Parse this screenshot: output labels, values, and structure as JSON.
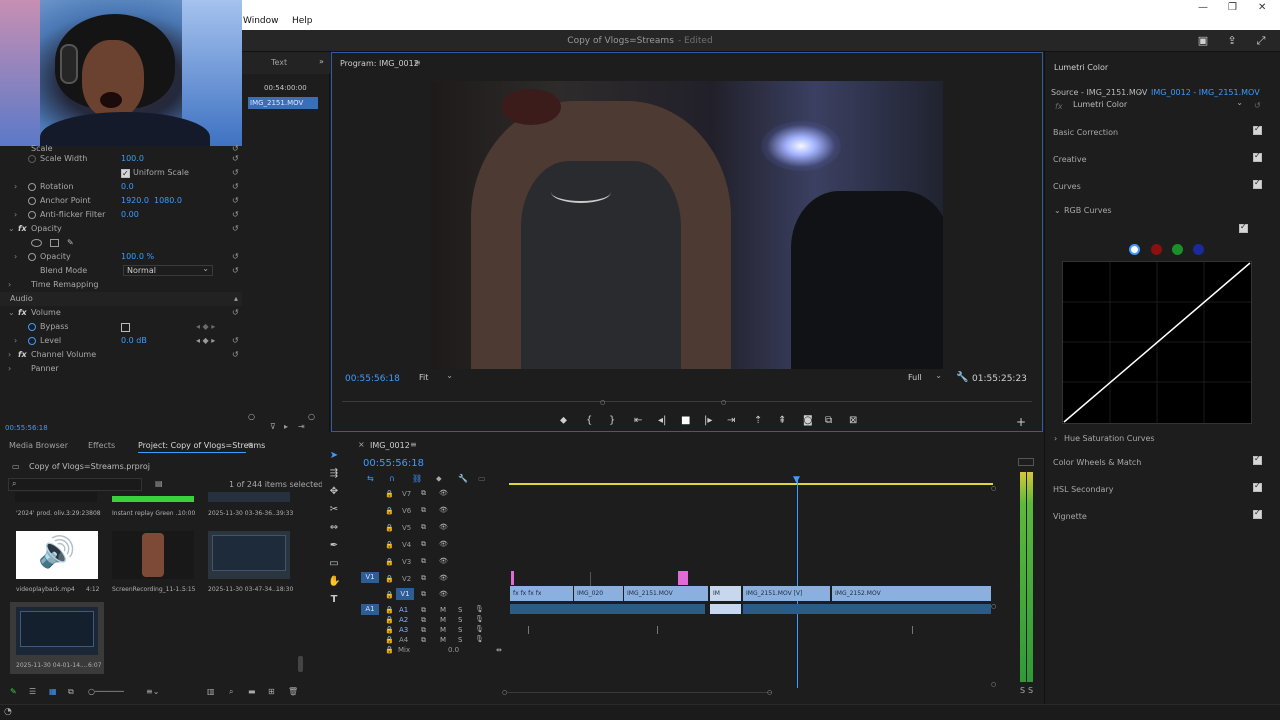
{
  "menu": {
    "items": [
      "Window",
      "Help"
    ]
  },
  "titlebar": {
    "document": "Copy of Vlogs=Streams",
    "status": "- Edited"
  },
  "source": {
    "tab": "Text",
    "timecode": "00:54:00:00",
    "clip": "IMG_2151.MOV"
  },
  "effect_controls": {
    "scale_label": "Scale",
    "scale_width_label": "Scale Width",
    "scale_width_value": "100.0",
    "uniform_scale": "Uniform Scale",
    "rotation_label": "Rotation",
    "rotation_value": "0.0",
    "anchor_label": "Anchor Point",
    "anchor_x": "1920.0",
    "anchor_y": "1080.0",
    "antiflicker_label": "Anti-flicker Filter",
    "antiflicker_value": "0.00",
    "opacity_section": "Opacity",
    "opacity_label": "Opacity",
    "opacity_value": "100.0 %",
    "blend_label": "Blend Mode",
    "blend_value": "Normal",
    "time_remap": "Time Remapping",
    "audio_label": "Audio",
    "volume_section": "Volume",
    "bypass_label": "Bypass",
    "level_label": "Level",
    "level_value": "0.0 dB",
    "channel_volume": "Channel Volume",
    "panner": "Panner",
    "timecode": "00:55:56:18"
  },
  "program": {
    "title": "Program: IMG_0012",
    "timecode": "00:55:56:18",
    "fit": "Fit",
    "quality": "Full",
    "duration": "01:55:25:23"
  },
  "lumetri": {
    "title": "Lumetri Color",
    "source": "Source - IMG_2151.MOV",
    "target": "IMG_0012 - IMG_2151.MOV",
    "effect": "Lumetri Color",
    "sections": [
      "Basic Correction",
      "Creative",
      "Curves"
    ],
    "rgb_curves": "RGB Curves",
    "hue_sat": "Hue Saturation Curves",
    "lower_sections": [
      "Color Wheels & Match",
      "HSL Secondary",
      "Vignette"
    ],
    "curve_colors": [
      "#ffffff",
      "#8b1010",
      "#1a8f2a",
      "#1a2a9a"
    ]
  },
  "project": {
    "tabs": [
      "Media Browser",
      "Effects",
      "Project: Copy of Vlogs=Streams"
    ],
    "file": "Copy of Vlogs=Streams.prproj",
    "selection": "1 of 244 items selected",
    "items": [
      {
        "name": "'2024' prod. oliv...",
        "dur": "3:29:23808"
      },
      {
        "name": "Instant replay Green ...",
        "dur": "10:00"
      },
      {
        "name": "2025-11-30 03-36-36....",
        "dur": "39:33"
      },
      {
        "name": "videoplayback.mp4",
        "dur": "4:12"
      },
      {
        "name": "ScreenRecording_11-1...",
        "dur": "5:15"
      },
      {
        "name": "2025-11-30 03-47-34....",
        "dur": "18:30"
      },
      {
        "name": "2025-11-30 04-01-14....",
        "dur": "6:07"
      }
    ]
  },
  "timeline": {
    "sequence": "IMG_0012",
    "timecode": "00:55:56:18",
    "video_tracks": [
      "V7",
      "V6",
      "V5",
      "V4",
      "V3",
      "V2",
      "V1"
    ],
    "audio_tracks": [
      "A1",
      "A2",
      "A3",
      "A4"
    ],
    "mix_label": "Mix",
    "mix_value": "0.0",
    "target_v": "V1",
    "target_a": "A1",
    "clips": [
      "IMG_020",
      "IMG_2151.MOV",
      "IM",
      "IMG_2151.MOV [V]",
      "IMG_2152.MOV"
    ]
  },
  "meter": {
    "label_l": "S",
    "label_r": "S"
  }
}
